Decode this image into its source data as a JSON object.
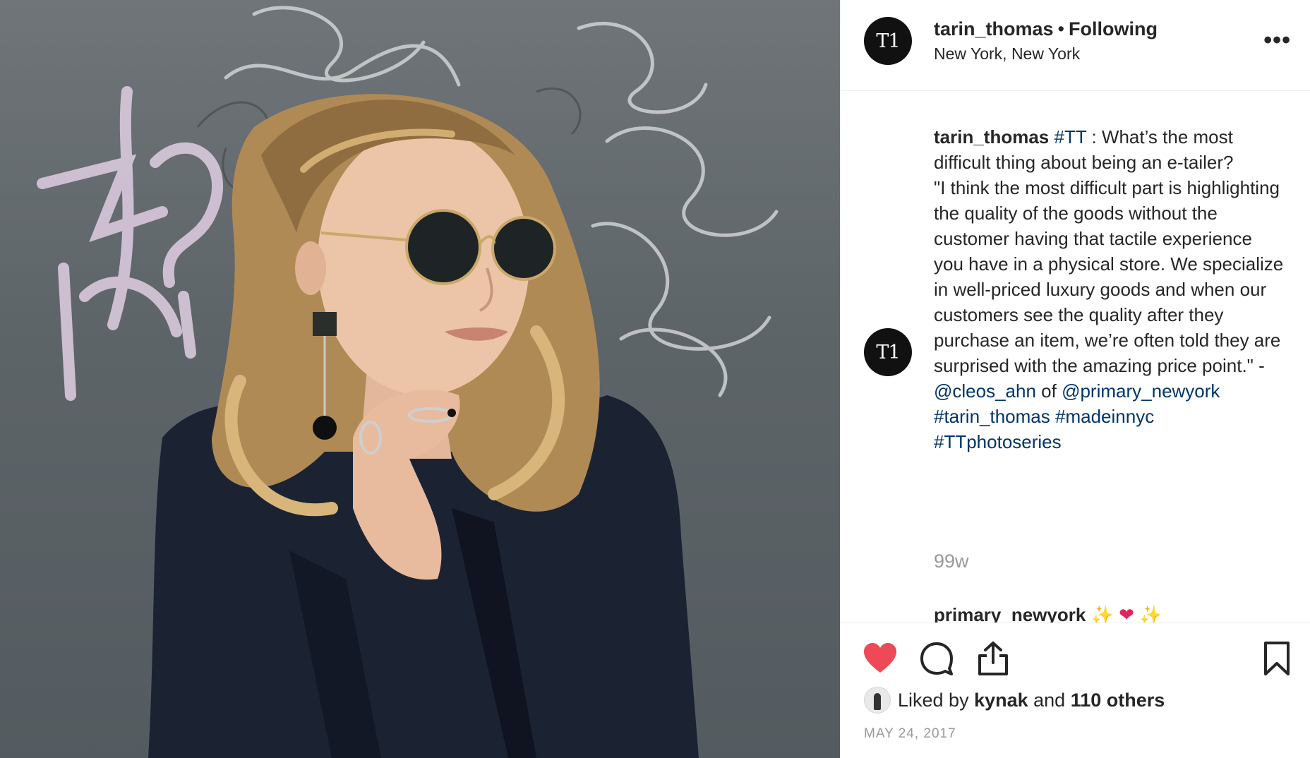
{
  "header": {
    "avatar_text": "T1",
    "username": "tarin_thomas",
    "separator": "•",
    "follow_status": "Following",
    "location": "New York, New York",
    "more_icon": "more-horizontal-icon",
    "more_glyph": "•••"
  },
  "caption": {
    "avatar_text": "T1",
    "username": "tarin_thomas",
    "hashtag_tt": "#TT",
    "text_1": " : What’s the most difficult thing about being an e-tailer?",
    "text_2": "\"I think the most difficult part is highlighting the quality of the goods without the customer having that tactile experience you have in a physical store. We specialize in well-priced luxury goods and when our customers see the quality after they purchase an item, we’re often told they are surprised with the amazing price point.\" - ",
    "mention_1": "@cleos_ahn",
    "text_3": " of ",
    "mention_2": "@primary_newyork",
    "hashtag_1": "#tarin_thomas",
    "hashtag_2": "#madeinnyc",
    "hashtag_3": "#TTphotoseries",
    "time_ago": "99w"
  },
  "reply": {
    "username": "primary_newyork",
    "emoji_1": "✨",
    "emoji_2": "❤",
    "emoji_3": "✨"
  },
  "actions": {
    "like_icon": "heart-filled-icon",
    "like_color": "#ed4956",
    "comment_icon": "comment-icon",
    "share_icon": "share-icon",
    "save_icon": "bookmark-icon"
  },
  "likes": {
    "prefix": "Liked by ",
    "user": "kynak",
    "middle": " and ",
    "others": "110 others"
  },
  "date": "MAY 24, 2017",
  "colors": {
    "link": "#003569",
    "muted": "#999999",
    "text": "#262626"
  }
}
